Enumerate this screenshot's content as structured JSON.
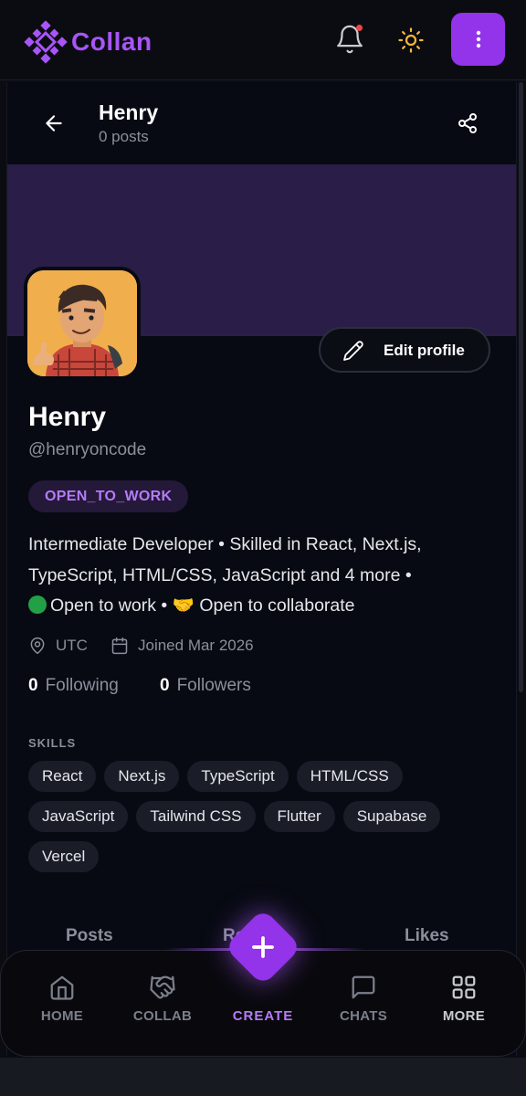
{
  "app": {
    "name": "Collan",
    "brand_color": "#a855f7",
    "accent_color": "#9333ea"
  },
  "header": {
    "title": "Henry",
    "subtitle": "0 posts"
  },
  "profile": {
    "name": "Henry",
    "handle": "@henryoncode",
    "status_badge": "OPEN_TO_WORK",
    "edit_button": "Edit profile",
    "bio": {
      "line1": "Intermediate Developer • Skilled in React, Next.js,",
      "line2": "TypeScript, HTML/CSS, JavaScript and 4 more •",
      "line3": "Open to work • 🤝 Open to collaborate"
    },
    "location": "UTC",
    "joined": "Joined Mar 2026",
    "following_count": "0",
    "following_label": "Following",
    "followers_count": "0",
    "followers_label": "Followers"
  },
  "skills": {
    "title": "SKILLS",
    "items": [
      "React",
      "Next.js",
      "TypeScript",
      "HTML/CSS",
      "JavaScript",
      "Tailwind CSS",
      "Flutter",
      "Supabase",
      "Vercel"
    ]
  },
  "tabs": {
    "posts": "Posts",
    "replies": "Replies",
    "likes": "Likes"
  },
  "nav": {
    "home": "HOME",
    "collab": "COLLAB",
    "create": "CREATE",
    "chats": "CHATS",
    "more": "MORE"
  },
  "icons": {
    "logo": "collan-logo-icon",
    "notifications": "bell-icon",
    "theme": "sun-icon",
    "menu": "kebab-menu-icon",
    "back": "arrow-left-icon",
    "share": "share-icon",
    "edit": "pencil-icon",
    "location": "map-pin-icon",
    "calendar": "calendar-icon"
  }
}
